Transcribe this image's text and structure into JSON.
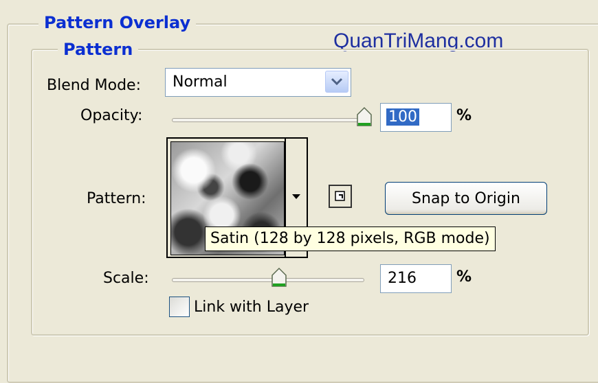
{
  "watermark": "QuanTriMang.com",
  "pattern_overlay": {
    "title": "Pattern Overlay",
    "pattern_group": {
      "title": "Pattern",
      "blend_mode": {
        "label": "Blend Mode:",
        "value": "Normal",
        "icon": "chevron-down-icon"
      },
      "opacity": {
        "label": "Opacity:",
        "value": "100",
        "unit": "%",
        "slider_fraction": 1.0
      },
      "pattern": {
        "label": "Pattern:",
        "picker_icon": "dropdown-arrow-icon",
        "new_preset_icon": "new-preset-icon",
        "snap_button": "Snap to Origin",
        "tooltip": "Satin (128 by 128 pixels, RGB mode)"
      },
      "scale": {
        "label": "Scale:",
        "value": "216",
        "unit": "%",
        "slider_fraction": 0.55
      },
      "link_with_layer": {
        "label": "Link with Layer",
        "checked": false
      }
    }
  },
  "colors": {
    "background": "#ece9d8",
    "heading": "#0b2fd1",
    "watermark": "#1e2fa0",
    "selection": "#316ac5",
    "tooltip_bg": "#ffffe1"
  }
}
